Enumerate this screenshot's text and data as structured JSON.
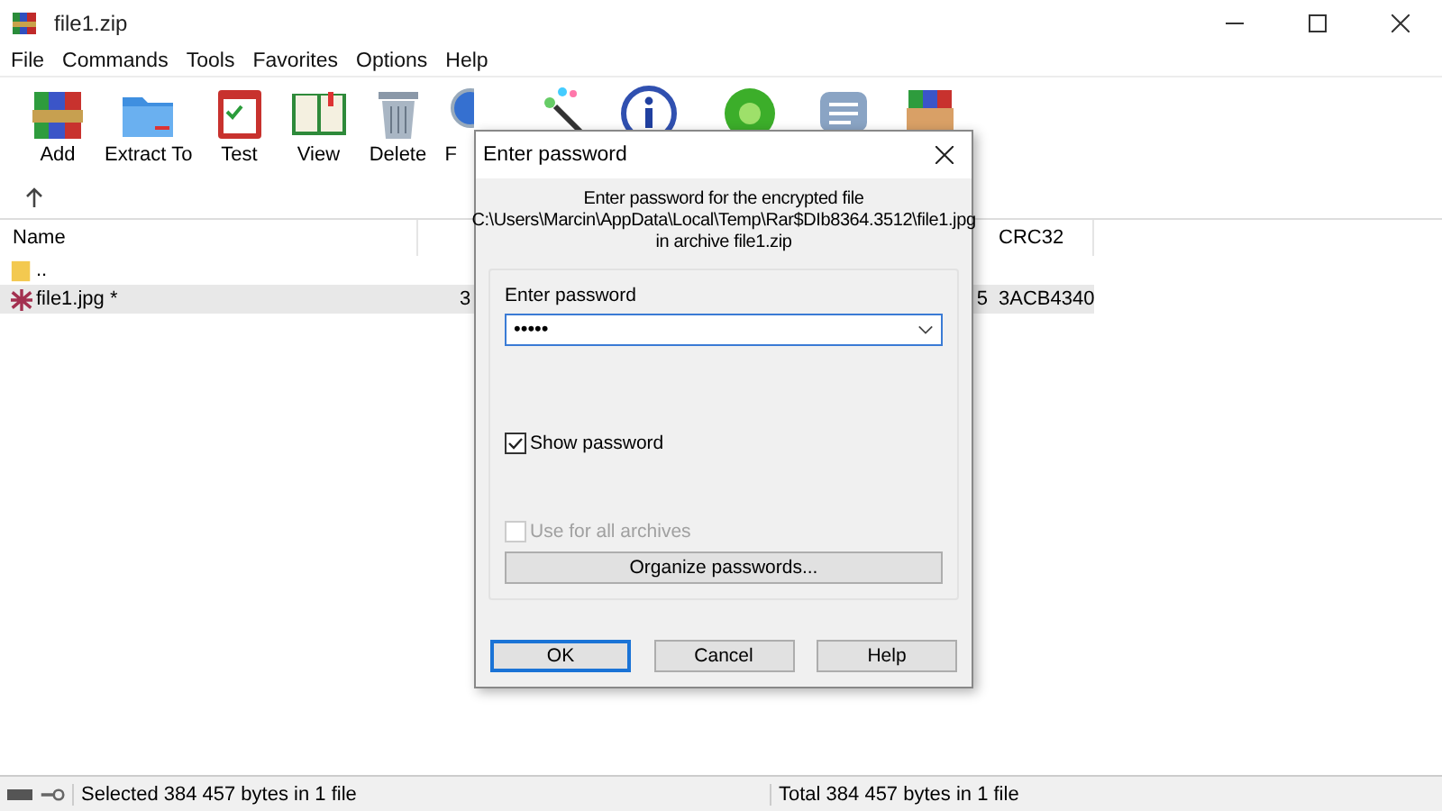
{
  "window": {
    "title": "file1.zip"
  },
  "menu": [
    "File",
    "Commands",
    "Tools",
    "Favorites",
    "Options",
    "Help"
  ],
  "toolbar": [
    {
      "label": "Add",
      "kind": "add"
    },
    {
      "label": "Extract To",
      "kind": "extract"
    },
    {
      "label": "Test",
      "kind": "test"
    },
    {
      "label": "View",
      "kind": "view"
    },
    {
      "label": "Delete",
      "kind": "delete"
    },
    {
      "label": "F",
      "kind": "find"
    }
  ],
  "table": {
    "columns": [
      {
        "label": "Name"
      },
      {
        "label": "CRC32"
      }
    ],
    "rows": [
      {
        "name": "..",
        "kind": "folder",
        "column_2": "",
        "column_3": "",
        "crc": "",
        "selected": false
      },
      {
        "name": "file1.jpg *",
        "kind": "file",
        "column_2": "3",
        "column_3": "5",
        "crc": "3ACB4340",
        "selected": true
      }
    ]
  },
  "dialog": {
    "title": "Enter password",
    "message": [
      "Enter password for the encrypted file",
      "C:\\Users\\Marcin\\AppData\\Local\\Temp\\Rar$DIb8364.3512\\file1.jpg",
      "in archive file1.zip"
    ],
    "field_label": "Enter password",
    "field_value": "•••••",
    "checkboxes": [
      {
        "label": "Show password",
        "checked": true,
        "disabled": false
      },
      {
        "label": "Use for all archives",
        "checked": false,
        "disabled": true
      }
    ],
    "organize_button": "Organize passwords...",
    "buttons": [
      {
        "label": "OK",
        "default": true
      },
      {
        "label": "Cancel",
        "default": false
      },
      {
        "label": "Help",
        "default": false
      }
    ]
  },
  "status_bar": {
    "left": "Selected 384 457 bytes in 1 file",
    "right": "Total 384 457 bytes in 1 file"
  }
}
